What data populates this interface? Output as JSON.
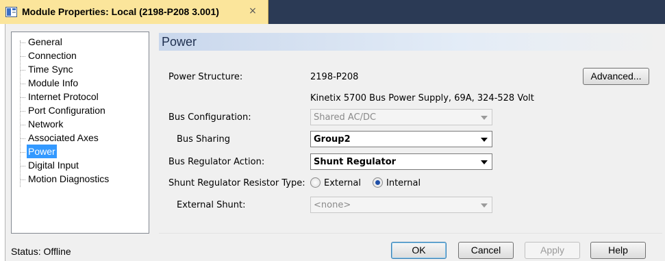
{
  "tab": {
    "title": "Module Properties: Local (2198-P208 3.001)",
    "close_glyph": "×",
    "icon": "module-icon"
  },
  "tree": {
    "items": [
      {
        "label": "General",
        "selected": false
      },
      {
        "label": "Connection",
        "selected": false
      },
      {
        "label": "Time Sync",
        "selected": false
      },
      {
        "label": "Module Info",
        "selected": false
      },
      {
        "label": "Internet Protocol",
        "selected": false
      },
      {
        "label": "Port Configuration",
        "selected": false
      },
      {
        "label": "Network",
        "selected": false
      },
      {
        "label": "Associated Axes",
        "selected": false
      },
      {
        "label": "Power",
        "selected": true
      },
      {
        "label": "Digital Input",
        "selected": false
      },
      {
        "label": "Motion Diagnostics",
        "selected": false
      }
    ]
  },
  "page": {
    "title": "Power",
    "power_structure_label": "Power Structure:",
    "power_structure_value": "2198-P208",
    "power_structure_desc": "Kinetix 5700 Bus Power Supply, 69A, 324-528 Volt",
    "advanced_button": "Advanced...",
    "bus_config_label": "Bus Configuration:",
    "bus_config_value": "Shared AC/DC",
    "bus_sharing_label": "Bus Sharing",
    "bus_sharing_value": "Group2",
    "bus_regulator_label": "Bus Regulator Action:",
    "bus_regulator_value": "Shunt Regulator",
    "shunt_type_label": "Shunt Regulator Resistor Type:",
    "shunt_external_label": "External",
    "shunt_internal_label": "Internal",
    "shunt_selected": "Internal",
    "external_shunt_label": "External Shunt:",
    "external_shunt_value": "<none>"
  },
  "footer": {
    "status": "Status:  Offline",
    "ok": "OK",
    "cancel": "Cancel",
    "apply": "Apply",
    "help": "Help"
  },
  "colors": {
    "tab_bg": "#fbe59b",
    "tabbar_bg": "#2b3a55",
    "selection": "#3399ff",
    "header_gradient_start": "#c9d7ec"
  }
}
